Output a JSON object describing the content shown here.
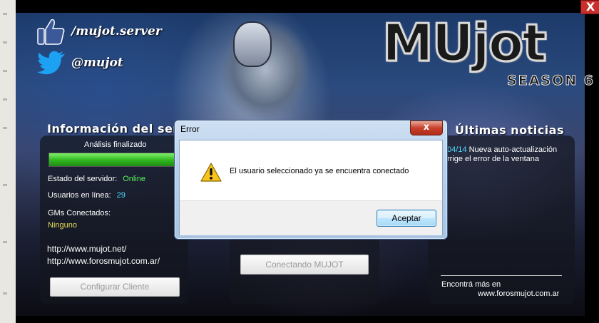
{
  "social": {
    "facebook_text": "/mujot.server",
    "twitter_text": "@mujot"
  },
  "logo": {
    "word": "MUjot",
    "season": "SEASON 6"
  },
  "window": {
    "close_glyph": "X"
  },
  "server_info": {
    "title": "Información del servicio",
    "analysis_label": "Análisis finalizado",
    "progress_percent": 100,
    "status_label": "Estado del servidor:",
    "status_value": "Online",
    "users_label": "Usuarios en línea:",
    "users_value": "29",
    "gms_label": "GMs Conectados:",
    "gms_value": "Ninguno",
    "link1": "http://www.mujot.net/",
    "link2": "http://www.forosmujot.com.ar/",
    "configure_button": "Configurar Cliente"
  },
  "connect": {
    "button": "Conectando MUJOT"
  },
  "news": {
    "title": "Últimas noticias",
    "item_date": "04/14",
    "item_line1": "Nueva auto-actualización",
    "item_line2": "rrige el error de la ventana",
    "more_label": "Encontrá más en",
    "more_url": "www.forosmujot.com.ar"
  },
  "dialog": {
    "title": "Error",
    "message": "El usuario seleccionado ya se encuentra conectado",
    "ok_button": "Aceptar",
    "close_glyph": "x",
    "icon": "warning-icon"
  },
  "colors": {
    "online": "#5cf25c",
    "users": "#4fd8ff",
    "gms": "#e5dc5a",
    "progress": "#2fb61e"
  }
}
